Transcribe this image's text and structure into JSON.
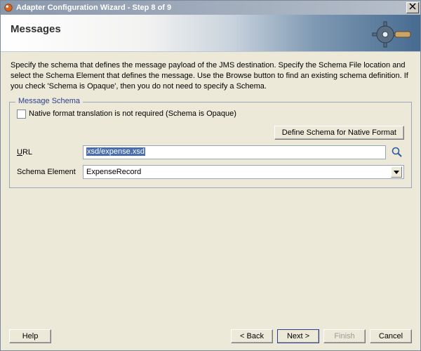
{
  "window": {
    "title": "Adapter Configuration Wizard - Step 8 of 9"
  },
  "header": {
    "title": "Messages"
  },
  "instructions": "Specify the schema that defines the message payload of the JMS destination.  Specify the Schema File location and select the Schema Element that defines the message. Use the Browse button to find an existing schema definition. If you check 'Schema is Opaque', then you do not need to specify a Schema.",
  "schema": {
    "legend": "Message Schema",
    "opaque_label": "Native format translation is not required (Schema is Opaque)",
    "opaque_checked": false,
    "define_btn": "Define Schema for Native Format",
    "url_label_pre": "U",
    "url_label_post": "RL",
    "url_value": "xsd/expense.xsd",
    "element_label": "Schema Element",
    "element_value": "ExpenseRecord"
  },
  "footer": {
    "help": "Help",
    "back": "< Back",
    "next": "Next >",
    "finish": "Finish",
    "cancel": "Cancel"
  }
}
